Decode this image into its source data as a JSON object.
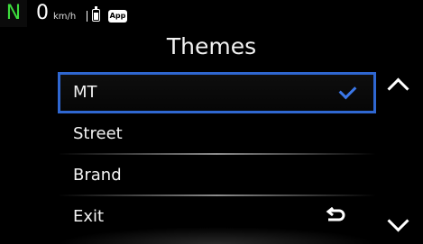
{
  "status": {
    "gear": "N",
    "speed": "0",
    "speed_unit": "km/h",
    "app_badge": "App",
    "gear_color": "#3ddc3d"
  },
  "screen": {
    "title": "Themes"
  },
  "menu": {
    "items": [
      {
        "label": "MT",
        "selected": true,
        "icon": "check-icon"
      },
      {
        "label": "Street"
      },
      {
        "label": "Brand"
      },
      {
        "label": "Exit",
        "icon": "back-arrow-icon"
      }
    ],
    "selection_color": "#2f67d1"
  },
  "nav": {
    "up_icon": "chevron-up-icon",
    "down_icon": "chevron-down-icon"
  }
}
